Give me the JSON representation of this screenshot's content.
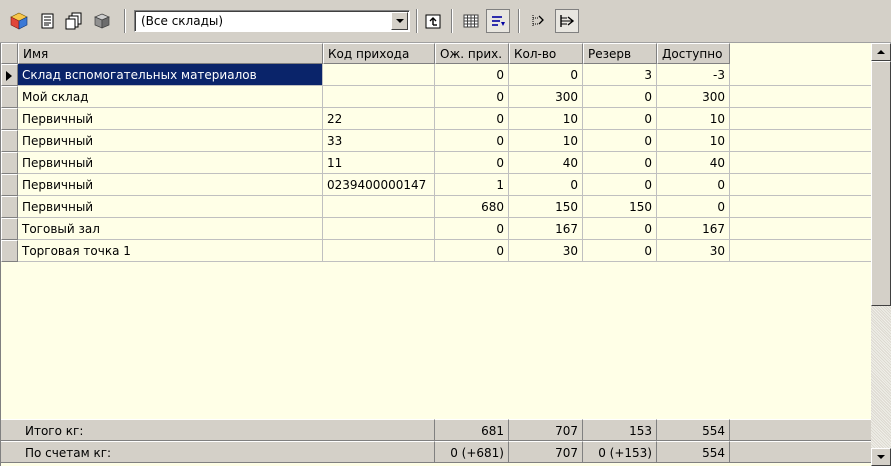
{
  "toolbar": {
    "buttons": [
      {
        "icon": "cube-color-icon"
      },
      {
        "icon": "document-icon"
      },
      {
        "icon": "documents-copy-icon"
      },
      {
        "icon": "box-gray-icon"
      },
      {
        "icon": "up-folder-icon"
      },
      {
        "icon": "grid-columns-icon"
      },
      {
        "icon": "filter-sort-icon"
      },
      {
        "icon": "tree-expand-icon"
      },
      {
        "icon": "tree-collapse-icon"
      }
    ],
    "warehouse_combo": {
      "selected": "(Все склады)"
    }
  },
  "table": {
    "columns": [
      "Имя",
      "Код прихода",
      "Ож. прих.",
      "Кол-во",
      "Резерв",
      "Доступно"
    ],
    "rows": [
      [
        "Склад вспомогательных материалов",
        "",
        "0",
        "0",
        "3",
        "-3"
      ],
      [
        "Мой склад",
        "",
        "0",
        "300",
        "0",
        "300"
      ],
      [
        "Первичный",
        "22",
        "0",
        "10",
        "0",
        "10"
      ],
      [
        "Первичный",
        "33",
        "0",
        "10",
        "0",
        "10"
      ],
      [
        "Первичный",
        "11",
        "0",
        "40",
        "0",
        "40"
      ],
      [
        "Первичный",
        "0239400000147",
        "1",
        "0",
        "0",
        "0"
      ],
      [
        "Первичный",
        "",
        "680",
        "150",
        "150",
        "0"
      ],
      [
        "Тоговый зал",
        "",
        "0",
        "167",
        "0",
        "167"
      ],
      [
        "Торговая точка 1",
        "",
        "0",
        "30",
        "0",
        "30"
      ]
    ],
    "selected_row": 0,
    "footer": [
      [
        "Итого кг:",
        "681",
        "707",
        "153",
        "554"
      ],
      [
        "По счетам кг:",
        "0 (+681)",
        "707",
        "0 (+153)",
        "554"
      ]
    ]
  },
  "colors": {
    "selection": "#0a246a",
    "grid_background": "#ffffe7",
    "chrome": "#d4d0c8"
  }
}
